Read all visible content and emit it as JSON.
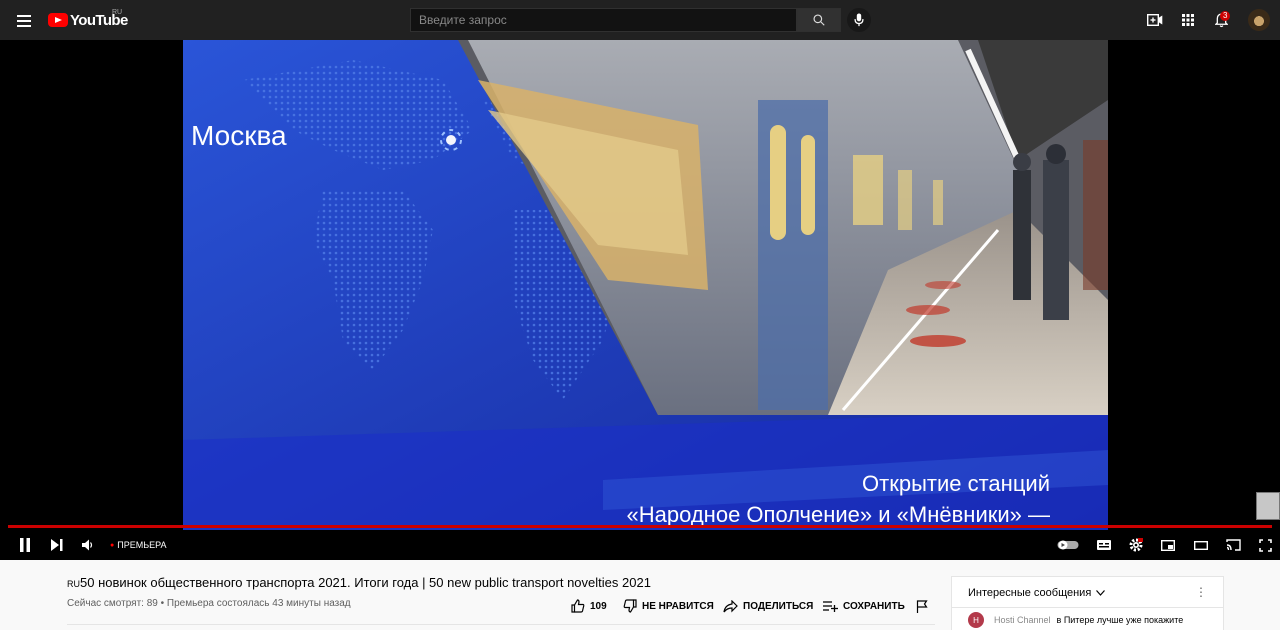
{
  "header": {
    "logo_text": "YouTube",
    "logo_region": "RU",
    "search_placeholder": "Введите запрос",
    "notification_count": "3"
  },
  "video": {
    "city_label": "Москва",
    "caption_line1": "Открытие станций",
    "caption_line2": "«Народное Ополчение» и «Мнёвники» —",
    "premiere_label": "ПРЕМЬЕРА",
    "progress": 1.0
  },
  "info": {
    "lang_tag": "RU",
    "title": "50 новинок общественного транспорта 2021. Итоги года | 50 new public transport novelties 2021",
    "meta": "Сейчас смотрят: 89 • Премьера состоялась 43 минуты назад",
    "likes": "109",
    "dislike_label": "НЕ НРАВИТСЯ",
    "share_label": "ПОДЕЛИТЬСЯ",
    "save_label": "СОХРАНИТЬ"
  },
  "chat": {
    "header": "Интересные сообщения",
    "message_author": "Hosti Channel",
    "message_text": "в Питере лучше уже покажите"
  },
  "colors": {
    "brand_red": "#ff0000",
    "progress_red": "#cc0000",
    "topbar_bg": "#212121"
  },
  "icons": [
    "menu-icon",
    "youtube-logo-icon",
    "search-icon",
    "mic-icon",
    "create-video-icon",
    "apps-icon",
    "bell-icon",
    "pause-icon",
    "next-icon",
    "volume-icon",
    "autoplay-toggle-icon",
    "subtitles-icon",
    "settings-icon",
    "miniplayer-icon",
    "theater-icon",
    "cast-icon",
    "fullscreen-icon",
    "like-icon",
    "dislike-icon",
    "share-icon",
    "save-icon",
    "flag-icon",
    "chevron-down-icon",
    "more-vert-icon"
  ]
}
